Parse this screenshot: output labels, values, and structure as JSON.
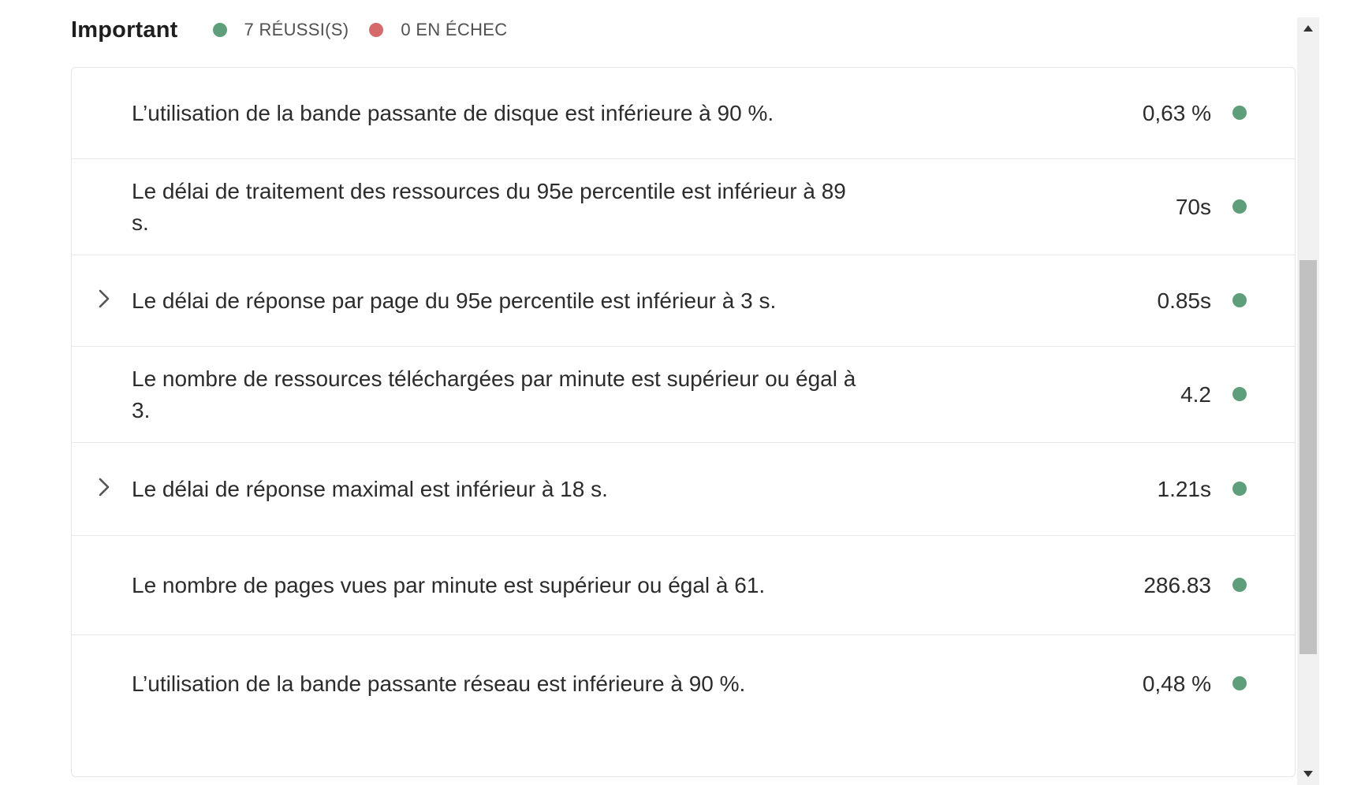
{
  "header": {
    "title": "Important",
    "passed_label": "7 RÉUSSI(S)",
    "failed_label": "0 EN ÉCHEC"
  },
  "colors": {
    "pass": "#5f9e7a",
    "fail": "#d46a6a"
  },
  "rows": [
    {
      "text": "L’utilisation de la bande passante de disque est inférieure à 90 %.",
      "value": "0,63 %",
      "expandable": false,
      "status": "pass"
    },
    {
      "text": "Le délai de traitement des ressources du 95e percentile est inférieur à 89 s.",
      "value": "70s",
      "expandable": false,
      "status": "pass"
    },
    {
      "text": "Le délai de réponse par page du 95e percentile est inférieur à 3 s.",
      "value": "0.85s",
      "expandable": true,
      "status": "pass"
    },
    {
      "text": "Le nombre de ressources téléchargées par minute est supérieur ou égal à 3.",
      "value": "4.2",
      "expandable": false,
      "status": "pass"
    },
    {
      "text": "Le délai de réponse maximal est inférieur à 18 s.",
      "value": "1.21s",
      "expandable": true,
      "status": "pass"
    },
    {
      "text": "Le nombre de pages vues par minute est supérieur ou égal à 61.",
      "value": "286.83",
      "expandable": false,
      "status": "pass"
    },
    {
      "text": "L’utilisation de la bande passante réseau est inférieure à 90 %.",
      "value": "0,48 %",
      "expandable": false,
      "status": "pass"
    }
  ]
}
